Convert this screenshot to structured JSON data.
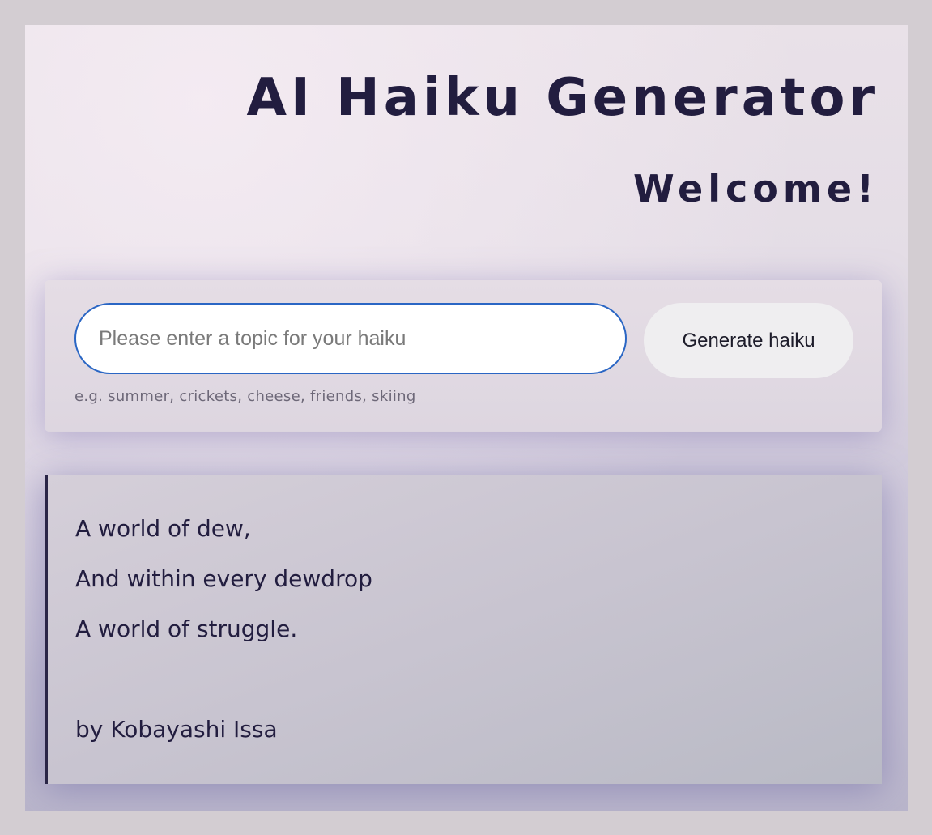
{
  "header": {
    "title": "AI Haiku Generator",
    "welcome": "Welcome!"
  },
  "form": {
    "input_placeholder": "Please enter a topic for your haiku",
    "input_value": "",
    "button_label": "Generate haiku",
    "hint": "e.g. summer, crickets, cheese, friends, skiing"
  },
  "haiku": {
    "lines": [
      "A world of dew,",
      "And within every dewdrop",
      "A world of struggle."
    ],
    "author": "by Kobayashi Issa"
  },
  "colors": {
    "text_primary": "#221d3f",
    "input_focus_border": "#2a66c4",
    "haiku_accent_border": "#2a2547",
    "outer_background": "#d3cdd2"
  }
}
